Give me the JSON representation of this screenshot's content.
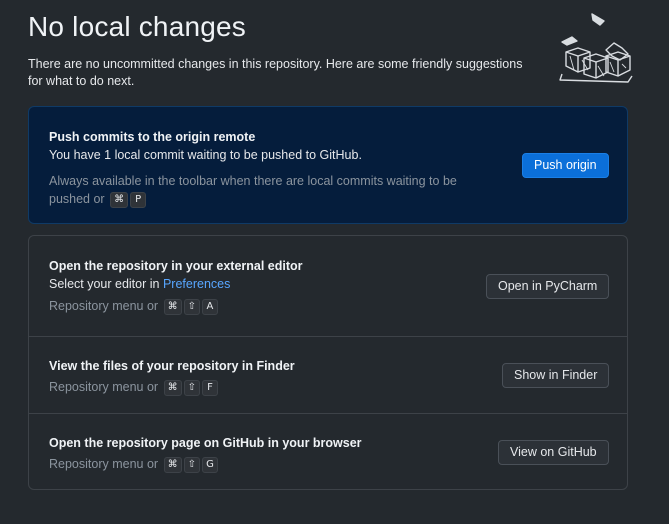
{
  "header": {
    "title": "No local changes",
    "subtitle": "There are no uncommitted changes in this repository. Here are some friendly suggestions for what to do next."
  },
  "push_card": {
    "heading": "Push commits to the origin remote",
    "description": "You have 1 local commit waiting to be pushed to GitHub.",
    "hint": "Always available in the toolbar when there are local commits waiting to be pushed or",
    "shortcut": [
      "⌘",
      "P"
    ],
    "button_label": "Push origin"
  },
  "suggestions": [
    {
      "heading": "Open the repository in your external editor",
      "description_prefix": "Select your editor in ",
      "description_link": "Preferences",
      "hint": "Repository menu or",
      "shortcut": [
        "⌘",
        "⇧",
        "A"
      ],
      "button_label": "Open in PyCharm"
    },
    {
      "heading": "View the files of your repository in Finder",
      "hint": "Repository menu or",
      "shortcut": [
        "⌘",
        "⇧",
        "F"
      ],
      "button_label": "Show in Finder"
    },
    {
      "heading": "Open the repository page on GitHub in your browser",
      "hint": "Repository menu or",
      "shortcut": [
        "⌘",
        "⇧",
        "G"
      ],
      "button_label": "View on GitHub"
    }
  ],
  "colors": {
    "background": "#24292e",
    "primary_card": "#051d3c",
    "primary_button": "#0b6fd9",
    "link": "#58a6ff"
  },
  "icons": [
    "empty-boxes-illustration"
  ]
}
